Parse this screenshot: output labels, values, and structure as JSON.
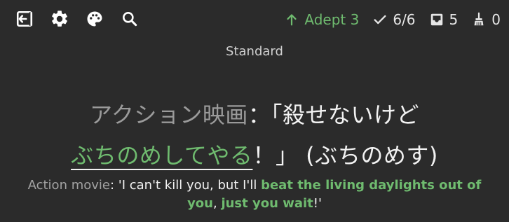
{
  "topbar": {
    "left_icons": [
      {
        "name": "exit-icon"
      },
      {
        "name": "gear-icon"
      },
      {
        "name": "palette-icon"
      },
      {
        "name": "search-icon"
      }
    ],
    "stats": {
      "adept_label": "Adept 3",
      "completed_label": "6/6",
      "inbox_count": "5",
      "sweep_count": "0"
    }
  },
  "deck": {
    "label": "Standard"
  },
  "sentence": {
    "topic": "アクション映画",
    "colon": "：",
    "bracket_open": "「",
    "prefix": "殺せないけど",
    "target": "ぶちのめしてやる",
    "suffix": "！」",
    "reading": "(ぶちのめす)"
  },
  "translation": {
    "topic": "Action movie",
    "part1": ": 'I can't kill you, but I'll ",
    "target1": "beat the living daylights out of you",
    "part2": ", ",
    "target2": "just you wait",
    "part3": "!'"
  },
  "colors": {
    "background": "#2b2b2b",
    "accent_green": "#6fbb6f",
    "text": "#f2f2f2",
    "muted": "#9a9a9a"
  }
}
